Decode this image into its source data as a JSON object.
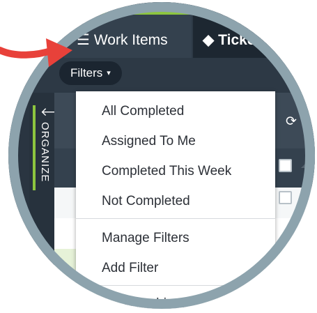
{
  "tabs": [
    {
      "label": "Work Items",
      "icon": "list-icon"
    },
    {
      "label": "Ticke",
      "icon": "ticket-icon"
    }
  ],
  "filters_button": {
    "label": "Filters",
    "caret": "▾"
  },
  "sidebar": {
    "label": "ORGANIZE",
    "back_arrow": "🡐"
  },
  "menu": {
    "items": [
      {
        "label": "All Completed"
      },
      {
        "label": "Assigned To Me"
      },
      {
        "label": "Completed This Week"
      },
      {
        "label": "Not Completed"
      }
    ],
    "manage_items": [
      {
        "label": "Manage Filters"
      },
      {
        "label": "Add Filter"
      }
    ],
    "archived_label": "w Archived"
  },
  "colors": {
    "accent_green": "#8dc63f",
    "annotation_red": "#e8413a",
    "chrome_dark": "#2d3945",
    "lens_border": "#8da3ad"
  }
}
